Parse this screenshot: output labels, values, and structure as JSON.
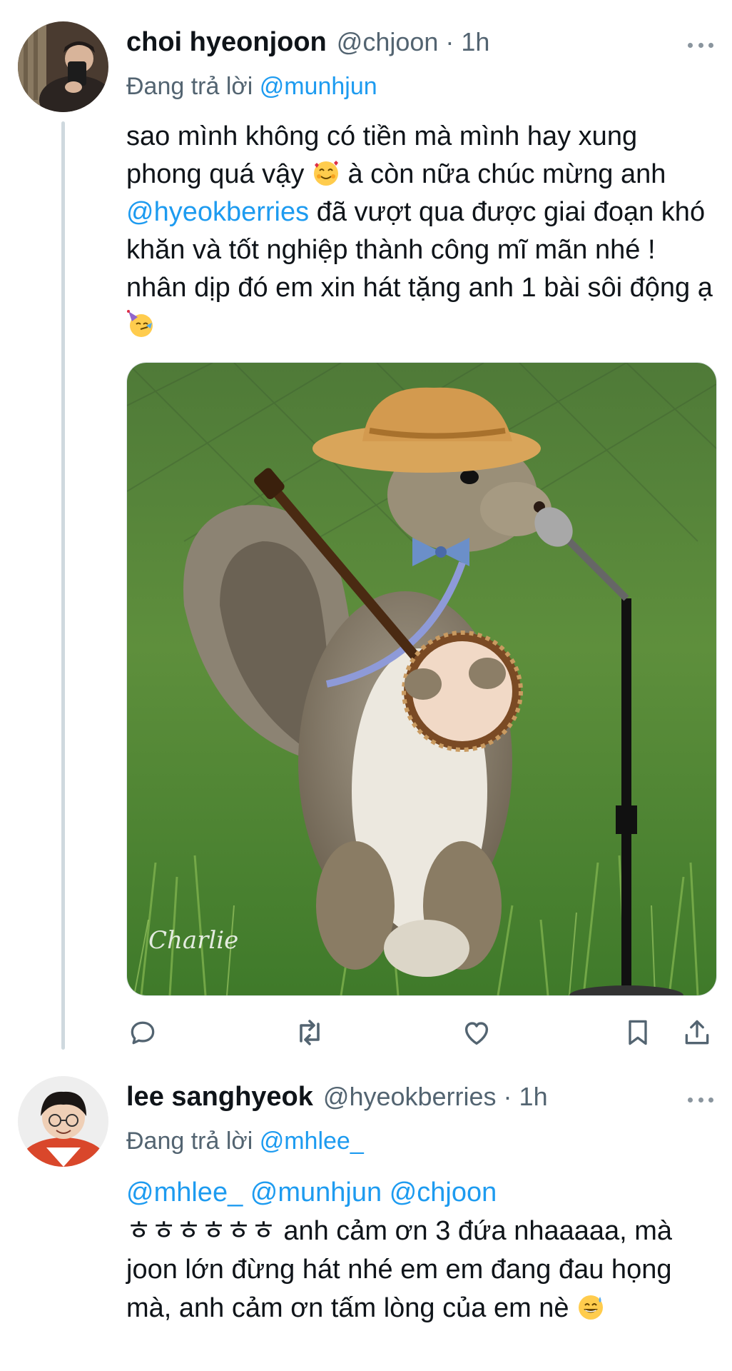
{
  "tweets": [
    {
      "display_name": "choi hyeonjoon",
      "meta": "@chjoon · 1h",
      "replying_prefix": "Đang trả lời",
      "replying_to": "@munhjun",
      "body_1": "sao mình không có tiền mà mình hay xung phong quá vậy",
      "body_2": "à còn nữa chúc mừng anh",
      "body_mention": "@hyeokberries",
      "body_3": "đã vượt qua được giai đoạn khó khăn và tốt nghiệp thành công mĩ mãn nhé ! nhân dịp đó em xin hát tặng anh 1 bài sôi động ạ",
      "emojis": [
        "smiling-face-with-hearts",
        "partying-face"
      ],
      "media_watermark": "Charlie",
      "media_subject": "squirrel-with-banjo"
    },
    {
      "display_name": "lee sanghyeok",
      "meta": "@hyeokberries · 1h",
      "replying_prefix": "Đang trả lời",
      "replying_to": "@mhlee_",
      "mentions": [
        "@mhlee_",
        "@munhjun",
        "@chjoon"
      ],
      "body_1": "ㅎㅎㅎㅎㅎㅎ anh cảm ơn 3 đứa nhaaaaa, mà joon lớn đừng hát nhé em em đang đau họng mà, anh cảm ơn tấm lòng của em nè",
      "emojis": [
        "grinning-face-with-sweat"
      ]
    }
  ],
  "actions": [
    "reply-icon",
    "retweet-icon",
    "like-icon",
    "bookmark-icon",
    "share-icon"
  ],
  "colors": {
    "link": "#1d9bf0",
    "secondary": "#536471",
    "text": "#0f1419",
    "thread_line": "#cfd9de"
  }
}
